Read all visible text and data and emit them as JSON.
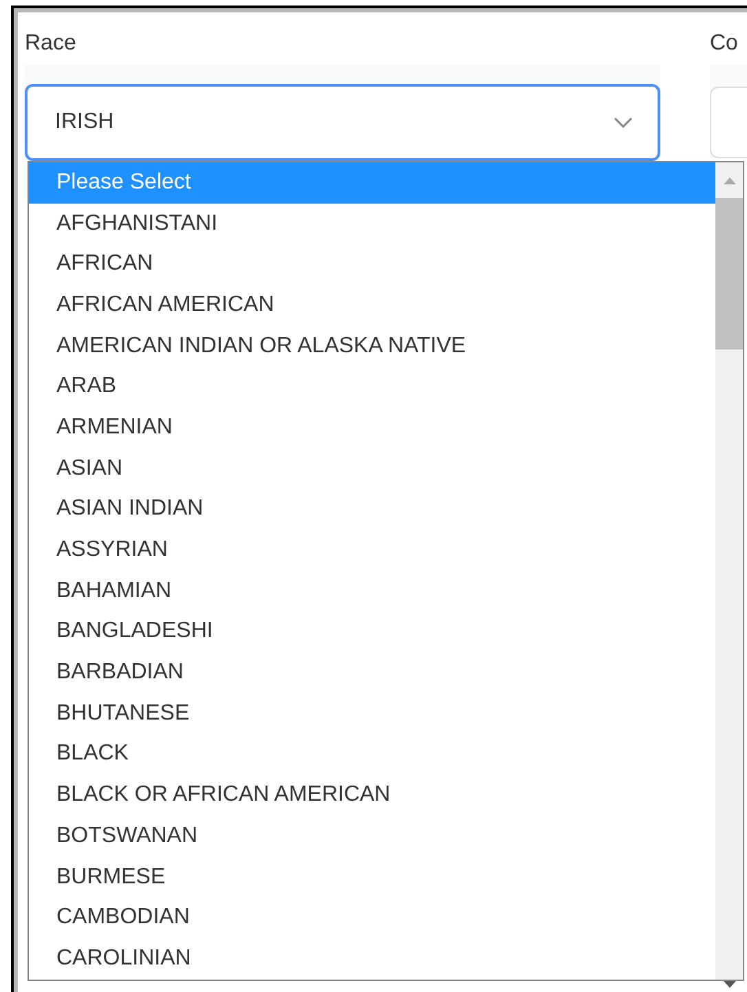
{
  "fields": [
    {
      "label": "Race",
      "value": "IRISH",
      "open": true
    },
    {
      "label": "Co",
      "open": false
    }
  ],
  "dropdown": {
    "options": [
      {
        "label": "Please Select",
        "selected": true
      },
      {
        "label": "AFGHANISTANI",
        "selected": false
      },
      {
        "label": "AFRICAN",
        "selected": false
      },
      {
        "label": "AFRICAN AMERICAN",
        "selected": false
      },
      {
        "label": "AMERICAN INDIAN OR ALASKA NATIVE",
        "selected": false
      },
      {
        "label": "ARAB",
        "selected": false
      },
      {
        "label": "ARMENIAN",
        "selected": false
      },
      {
        "label": "ASIAN",
        "selected": false
      },
      {
        "label": "ASIAN INDIAN",
        "selected": false
      },
      {
        "label": "ASSYRIAN",
        "selected": false
      },
      {
        "label": "BAHAMIAN",
        "selected": false
      },
      {
        "label": "BANGLADESHI",
        "selected": false
      },
      {
        "label": "BARBADIAN",
        "selected": false
      },
      {
        "label": "BHUTANESE",
        "selected": false
      },
      {
        "label": "BLACK",
        "selected": false
      },
      {
        "label": "BLACK OR AFRICAN AMERICAN",
        "selected": false
      },
      {
        "label": "BOTSWANAN",
        "selected": false
      },
      {
        "label": "BURMESE",
        "selected": false
      },
      {
        "label": "CAMBODIAN",
        "selected": false
      },
      {
        "label": "CAROLINIAN",
        "selected": false
      }
    ]
  }
}
